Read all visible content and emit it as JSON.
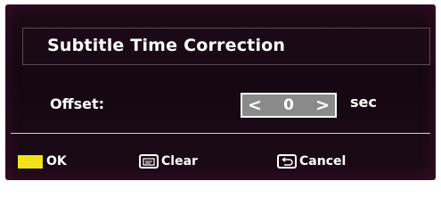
{
  "dialog": {
    "title": "Subtitle Time Correction"
  },
  "offset": {
    "label": "Offset:",
    "left_arrow": "<",
    "value": "0",
    "right_arrow": ">",
    "unit": "sec"
  },
  "footer": {
    "ok_label": "OK",
    "clear_label": "Clear",
    "cancel_label": "Cancel",
    "ok_key_color": "#f2e21a",
    "clear_icon": "subtitle-key-icon",
    "cancel_icon": "return-key-icon"
  }
}
